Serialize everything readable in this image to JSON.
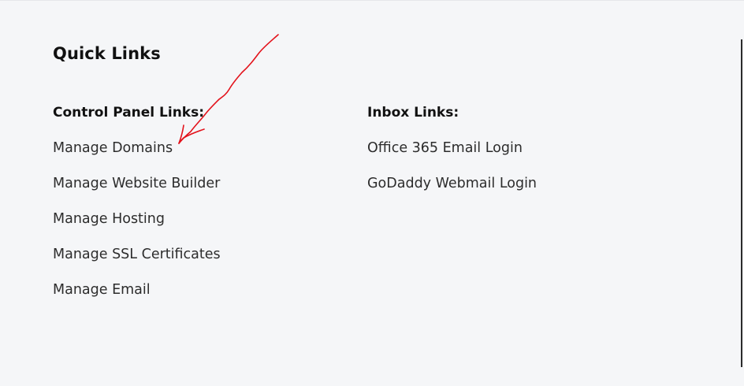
{
  "quick_links": {
    "title": "Quick Links",
    "control_panel": {
      "heading": "Control Panel Links:",
      "links": [
        "Manage Domains",
        "Manage Website Builder",
        "Manage Hosting",
        "Manage SSL Certificates",
        "Manage Email"
      ]
    },
    "inbox": {
      "heading": "Inbox Links:",
      "links": [
        "Office 365 Email Login",
        "GoDaddy Webmail Login"
      ]
    }
  },
  "annotation": {
    "type": "hand-drawn-arrow",
    "color": "#e3121b",
    "points_to": "Manage Domains"
  }
}
